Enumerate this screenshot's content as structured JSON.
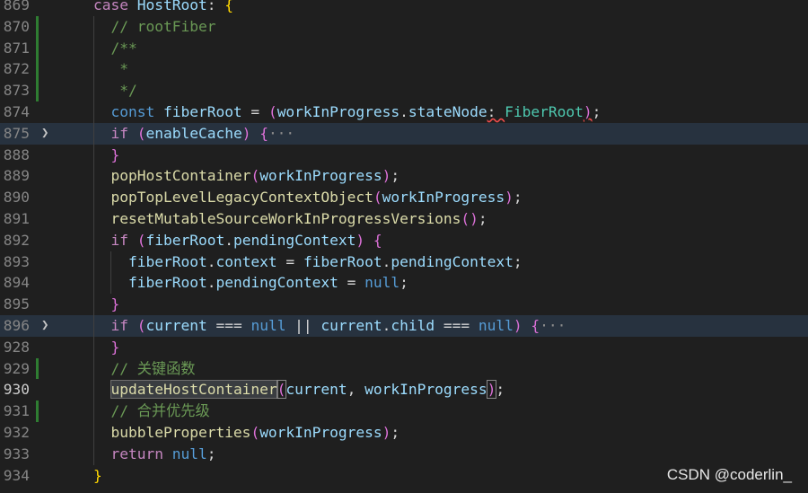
{
  "lines": [
    {
      "num": "869",
      "tokens": [
        {
          "t": "case ",
          "c": "kwc"
        },
        {
          "t": "HostRoot",
          "c": "var"
        },
        {
          "t": ": ",
          "c": "pu"
        },
        {
          "t": "{",
          "c": "b1"
        }
      ]
    },
    {
      "num": "870",
      "tokens": [
        {
          "t": "  // rootFiber",
          "c": "cm"
        }
      ]
    },
    {
      "num": "871",
      "tokens": [
        {
          "t": "  /**",
          "c": "cm"
        }
      ]
    },
    {
      "num": "872",
      "tokens": [
        {
          "t": "   *",
          "c": "cm"
        }
      ]
    },
    {
      "num": "873",
      "tokens": [
        {
          "t": "   */",
          "c": "cm"
        }
      ]
    },
    {
      "num": "874",
      "tokens": [
        {
          "t": "  const ",
          "c": "kw"
        },
        {
          "t": "fiberRoot",
          "c": "var"
        },
        {
          "t": " = ",
          "c": "pu"
        },
        {
          "t": "(",
          "c": "b2"
        },
        {
          "t": "workInProgress",
          "c": "var"
        },
        {
          "t": ".",
          "c": "pu"
        },
        {
          "t": "stateNode",
          "c": "var"
        },
        {
          "t": ": ",
          "c": "pu"
        },
        {
          "t": "FiberRoot",
          "c": "cls"
        },
        {
          "t": ")",
          "c": "b2"
        },
        {
          "t": ";",
          "c": "pu"
        }
      ]
    },
    {
      "num": "875",
      "tokens": [
        {
          "t": "  if ",
          "c": "kwc"
        },
        {
          "t": "(",
          "c": "b2"
        },
        {
          "t": "enableCache",
          "c": "var"
        },
        {
          "t": ") ",
          "c": "b2"
        },
        {
          "t": "{",
          "c": "b2"
        },
        {
          "t": "···",
          "c": "ell"
        }
      ]
    },
    {
      "num": "888",
      "tokens": [
        {
          "t": "  }",
          "c": "b2"
        }
      ]
    },
    {
      "num": "889",
      "tokens": [
        {
          "t": "  popHostContainer",
          "c": "fn"
        },
        {
          "t": "(",
          "c": "b2"
        },
        {
          "t": "workInProgress",
          "c": "var"
        },
        {
          "t": ")",
          "c": "b2"
        },
        {
          "t": ";",
          "c": "pu"
        }
      ]
    },
    {
      "num": "890",
      "tokens": [
        {
          "t": "  popTopLevelLegacyContextObject",
          "c": "fn"
        },
        {
          "t": "(",
          "c": "b2"
        },
        {
          "t": "workInProgress",
          "c": "var"
        },
        {
          "t": ")",
          "c": "b2"
        },
        {
          "t": ";",
          "c": "pu"
        }
      ]
    },
    {
      "num": "891",
      "tokens": [
        {
          "t": "  resetMutableSourceWorkInProgressVersions",
          "c": "fn"
        },
        {
          "t": "()",
          "c": "b2"
        },
        {
          "t": ";",
          "c": "pu"
        }
      ]
    },
    {
      "num": "892",
      "tokens": [
        {
          "t": "  if ",
          "c": "kwc"
        },
        {
          "t": "(",
          "c": "b2"
        },
        {
          "t": "fiberRoot",
          "c": "var"
        },
        {
          "t": ".",
          "c": "pu"
        },
        {
          "t": "pendingContext",
          "c": "var"
        },
        {
          "t": ") ",
          "c": "b2"
        },
        {
          "t": "{",
          "c": "b2"
        }
      ]
    },
    {
      "num": "893",
      "tokens": [
        {
          "t": "    fiberRoot",
          "c": "var"
        },
        {
          "t": ".",
          "c": "pu"
        },
        {
          "t": "context",
          "c": "var"
        },
        {
          "t": " = ",
          "c": "pu"
        },
        {
          "t": "fiberRoot",
          "c": "var"
        },
        {
          "t": ".",
          "c": "pu"
        },
        {
          "t": "pendingContext",
          "c": "var"
        },
        {
          "t": ";",
          "c": "pu"
        }
      ]
    },
    {
      "num": "894",
      "tokens": [
        {
          "t": "    fiberRoot",
          "c": "var"
        },
        {
          "t": ".",
          "c": "pu"
        },
        {
          "t": "pendingContext",
          "c": "var"
        },
        {
          "t": " = ",
          "c": "pu"
        },
        {
          "t": "null",
          "c": "kw"
        },
        {
          "t": ";",
          "c": "pu"
        }
      ]
    },
    {
      "num": "895",
      "tokens": [
        {
          "t": "  }",
          "c": "b2"
        }
      ]
    },
    {
      "num": "896",
      "tokens": [
        {
          "t": "  if ",
          "c": "kwc"
        },
        {
          "t": "(",
          "c": "b2"
        },
        {
          "t": "current",
          "c": "var"
        },
        {
          "t": " === ",
          "c": "pu"
        },
        {
          "t": "null",
          "c": "kw"
        },
        {
          "t": " || ",
          "c": "pu"
        },
        {
          "t": "current",
          "c": "var"
        },
        {
          "t": ".",
          "c": "pu"
        },
        {
          "t": "child",
          "c": "var"
        },
        {
          "t": " === ",
          "c": "pu"
        },
        {
          "t": "null",
          "c": "kw"
        },
        {
          "t": ") ",
          "c": "b2"
        },
        {
          "t": "{",
          "c": "b2"
        },
        {
          "t": "···",
          "c": "ell"
        }
      ]
    },
    {
      "num": "928",
      "tokens": [
        {
          "t": "  }",
          "c": "b2"
        }
      ]
    },
    {
      "num": "929",
      "tokens": [
        {
          "t": "  // 关键函数",
          "c": "cm"
        }
      ]
    },
    {
      "num": "930",
      "tokens": [
        {
          "t": "  ",
          "c": "pu"
        },
        {
          "t": "updateHostContainer",
          "c": "fn",
          "sel": true
        },
        {
          "t": "(",
          "c": "b2",
          "brk": true
        },
        {
          "t": "current",
          "c": "var"
        },
        {
          "t": ", ",
          "c": "pu"
        },
        {
          "t": "workInProgress",
          "c": "var"
        },
        {
          "t": ")",
          "c": "b2",
          "brk": true
        },
        {
          "t": ";",
          "c": "pu"
        }
      ]
    },
    {
      "num": "931",
      "tokens": [
        {
          "t": "  // 合并优先级",
          "c": "cm"
        }
      ]
    },
    {
      "num": "932",
      "tokens": [
        {
          "t": "  bubbleProperties",
          "c": "fn"
        },
        {
          "t": "(",
          "c": "b2"
        },
        {
          "t": "workInProgress",
          "c": "var"
        },
        {
          "t": ")",
          "c": "b2"
        },
        {
          "t": ";",
          "c": "pu"
        }
      ]
    },
    {
      "num": "933",
      "tokens": [
        {
          "t": "  return ",
          "c": "kwc"
        },
        {
          "t": "null",
          "c": "kw"
        },
        {
          "t": ";",
          "c": "pu"
        }
      ]
    },
    {
      "num": "934",
      "tokens": [
        {
          "t": "}",
          "c": "b1"
        }
      ]
    }
  ],
  "modified_lines": [
    "870",
    "871",
    "872",
    "873",
    "929",
    "931"
  ],
  "folded_lines": [
    "875",
    "896"
  ],
  "highlighted_lines": [
    "875",
    "896"
  ],
  "active_line": "930",
  "watermark": "CSDN @coderlin_"
}
